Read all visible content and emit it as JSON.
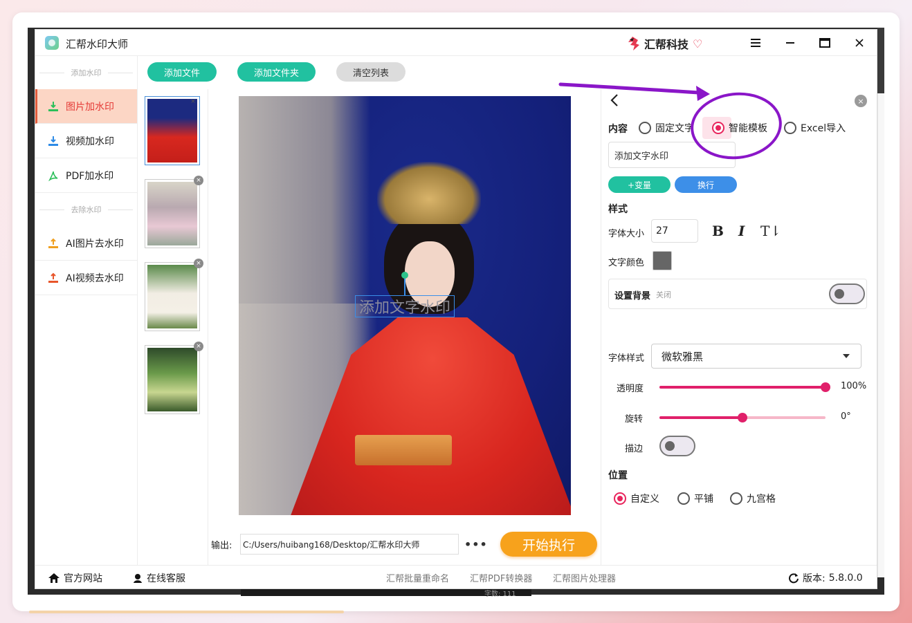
{
  "window": {
    "app_title": "汇帮水印大师",
    "brand_name": "汇帮科技"
  },
  "sidebar": {
    "sections": [
      {
        "title": "添加水印",
        "items": [
          {
            "label": "图片加水印",
            "active": true,
            "icon": "download-tray-icon",
            "color": "#2cbf5a"
          },
          {
            "label": "视频加水印",
            "active": false,
            "icon": "download-tray-icon",
            "color": "#2e8be6"
          },
          {
            "label": "PDF加水印",
            "active": false,
            "icon": "pdf-acrobat-icon",
            "color": "#2cbf5a"
          }
        ]
      },
      {
        "title": "去除水印",
        "items": [
          {
            "label": "AI图片去水印",
            "active": false,
            "icon": "upload-tray-icon",
            "color": "#f0a020"
          },
          {
            "label": "AI视频去水印",
            "active": false,
            "icon": "upload-tray-icon",
            "color": "#e8552a"
          }
        ]
      }
    ]
  },
  "toolbar": {
    "add_file": "添加文件",
    "add_folder": "添加文件夹",
    "clear_list": "清空列表"
  },
  "preview": {
    "watermark_text": "添加文字水印"
  },
  "output": {
    "label": "输出:",
    "path": "C:/Users/huibang168/Desktop/汇帮水印大师",
    "more": "•••",
    "start": "开始执行"
  },
  "panel": {
    "content_label": "内容",
    "content_options": [
      "固定文字",
      "智能模板",
      "Excel导入"
    ],
    "content_selected": 1,
    "text_value": "添加文字水印",
    "variable_btn": "+变量",
    "newline_btn": "换行",
    "style_label": "样式",
    "font_size_label": "字体大小",
    "font_size": "27",
    "bold": "B",
    "italic": "I",
    "t_btn": "T⇂",
    "text_color_label": "文字颜色",
    "text_color": "#666666",
    "bg_label": "设置背景",
    "bg_state": "关闭",
    "font_style_label": "字体样式",
    "font_family": "微软雅黑",
    "opacity_label": "透明度",
    "opacity_value": "100%",
    "opacity_fraction": 1.0,
    "rotation_label": "旋转",
    "rotation_value": "0°",
    "rotation_fraction": 0.5,
    "stroke_label": "描边",
    "position_label": "位置",
    "position_options": [
      "自定义",
      "平铺",
      "九宫格"
    ],
    "position_selected": 0
  },
  "statusbar": {
    "website": "官方网站",
    "support": "在线客服",
    "links": [
      "汇帮批量重命名",
      "汇帮PDF转换器",
      "汇帮图片处理器"
    ],
    "version_label": "版本:",
    "version": "5.8.0.0"
  },
  "colors": {
    "teal": "#21c1a0",
    "accent_pink": "#e8245c",
    "start_orange": "#f7a21c",
    "annotation_purple": "#8a16c8",
    "active_sidebar": "#fcd6c5"
  },
  "background": {
    "word_count": "字数: 111"
  }
}
